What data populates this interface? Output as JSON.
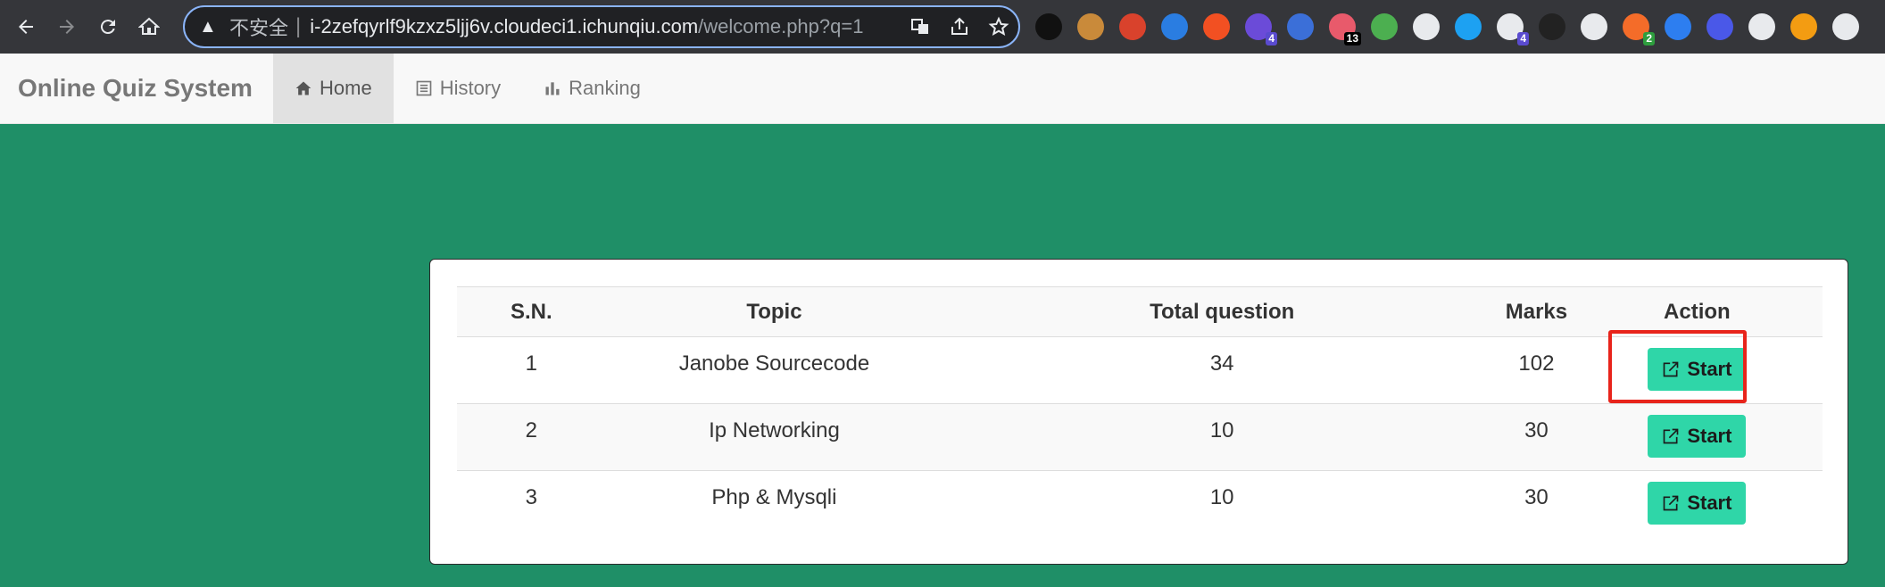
{
  "browser": {
    "security_label": "不安全",
    "url_host": "i-2zefqyrlf9kzxz5ljj6v.cloudeci1.ichunqiu.com",
    "url_path": "/welcome.php?q=1",
    "extensions": [
      {
        "icon": "black-circle-icon",
        "color": "#111111",
        "badge": ""
      },
      {
        "icon": "cookie-icon",
        "color": "#c98a3a",
        "badge": ""
      },
      {
        "icon": "dice-icon",
        "color": "#d9422c",
        "badge": ""
      },
      {
        "icon": "mask-icon",
        "color": "#2a7de1",
        "badge": ""
      },
      {
        "icon": "translate-icon",
        "color": "#f25022",
        "badge": ""
      },
      {
        "icon": "cube-icon",
        "color": "#6b4bd8",
        "badge": "4"
      },
      {
        "icon": "firefox-icon",
        "color": "#3b6fd8",
        "badge": ""
      },
      {
        "icon": "rocket-icon",
        "color": "#e85a6b",
        "badge": "13"
      },
      {
        "icon": "globe-icon",
        "color": "#4caf50",
        "badge": ""
      },
      {
        "icon": "ip-icon",
        "color": "#e8eaed",
        "badge": ""
      },
      {
        "icon": "shapes-icon",
        "color": "#1da1f2",
        "badge": ""
      },
      {
        "icon": "qr-icon",
        "color": "#e8eaed",
        "badge": "4"
      },
      {
        "icon": "hat-icon",
        "color": "#222222",
        "badge": ""
      },
      {
        "icon": "spy-icon",
        "color": "#e8eaed",
        "badge": ""
      },
      {
        "icon": "tool-icon",
        "color": "#f46c29",
        "badge": "2"
      },
      {
        "icon": "bars-icon",
        "color": "#2d7ef0",
        "badge": ""
      },
      {
        "icon": "moon-icon",
        "color": "#4a58e8",
        "badge": ""
      },
      {
        "icon": "glasses-icon",
        "color": "#e8eaed",
        "badge": ""
      },
      {
        "icon": "arrow-out-icon",
        "color": "#f39c12",
        "badge": ""
      },
      {
        "icon": "sidepanel-icon",
        "color": "#e8eaed",
        "badge": ""
      }
    ]
  },
  "navbar": {
    "brand": "Online Quiz System",
    "items": [
      {
        "label": "Home",
        "icon": "home-icon",
        "active": true
      },
      {
        "label": "History",
        "icon": "list-icon",
        "active": false
      },
      {
        "label": "Ranking",
        "icon": "bar-chart-icon",
        "active": false
      }
    ]
  },
  "table": {
    "headers": [
      "S.N.",
      "Topic",
      "Total question",
      "Marks",
      "Action"
    ],
    "rows": [
      {
        "sn": "1",
        "topic": "Janobe Sourcecode",
        "total": "34",
        "marks": "102",
        "action": "Start"
      },
      {
        "sn": "2",
        "topic": "Ip Networking",
        "total": "10",
        "marks": "30",
        "action": "Start"
      },
      {
        "sn": "3",
        "topic": "Php & Mysqli",
        "total": "10",
        "marks": "30",
        "action": "Start"
      }
    ]
  },
  "colors": {
    "page_background": "#1f8f67",
    "start_button": "#2fd6a8",
    "highlight_box": "#e8241b"
  }
}
